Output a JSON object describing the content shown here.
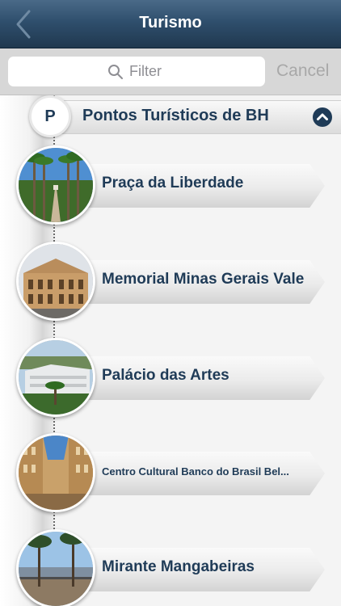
{
  "navbar": {
    "title": "Turismo"
  },
  "search": {
    "placeholder": "Filter",
    "value": "",
    "cancel_label": "Cancel"
  },
  "section": {
    "letter": "P",
    "title": "Pontos Turísticos de BH"
  },
  "items": [
    {
      "label": "Praça da Liberdade",
      "image": "palm-avenue-photo"
    },
    {
      "label": "Memorial Minas Gerais Vale",
      "image": "historic-building-photo"
    },
    {
      "label": "Palácio das Artes",
      "image": "modern-building-photo"
    },
    {
      "label": "Centro Cultural Banco do Brasil Bel...",
      "image": "atrium-photo"
    },
    {
      "label": "Mirante Mangabeiras",
      "image": "lookout-photo"
    }
  ],
  "colors": {
    "navbar": "#2f4f6d",
    "text_dark_blue": "#1f3b57",
    "cancel": "#a8a8a8"
  }
}
